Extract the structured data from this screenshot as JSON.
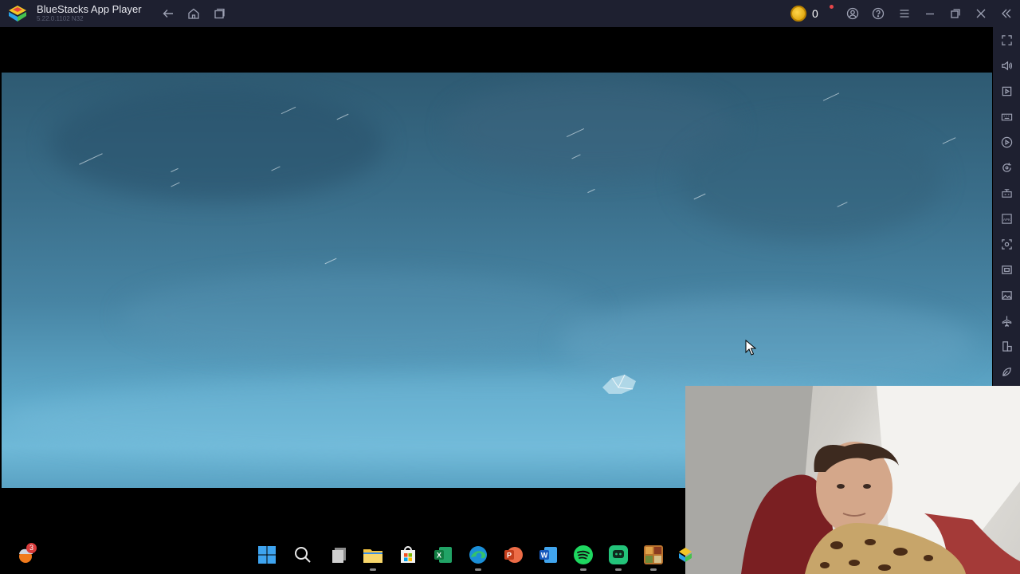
{
  "window": {
    "title": "BlueStacks App Player",
    "version": "5.22.0.1102  N32",
    "coins": "0"
  },
  "titlebar_buttons": [
    "back-icon",
    "home-icon",
    "multi-instance-icon",
    "account-icon",
    "help-icon",
    "menu-icon",
    "minimize-icon",
    "restore-icon",
    "close-icon",
    "collapse-sidebar-icon"
  ],
  "sidebar_buttons": [
    "fullscreen-icon",
    "volume-icon",
    "media-folder-icon",
    "keyboard-controls-icon",
    "macro-play-icon",
    "sync-icon",
    "game-controls-icon",
    "install-apk-icon",
    "screenshot-icon",
    "record-icon",
    "gallery-icon",
    "airplane-mode-icon",
    "rotate-icon",
    "eco-mode-icon"
  ],
  "taskbar": {
    "notification_badge": "3",
    "apps": [
      "windows-start-icon",
      "search-icon",
      "task-view-icon",
      "file-explorer-icon",
      "microsoft-store-icon",
      "excel-icon",
      "edge-icon",
      "powerpoint-icon",
      "word-icon",
      "spotify-icon",
      "messenger-icon",
      "game-app-icon",
      "bluestacks-taskbar-icon"
    ]
  },
  "colors": {
    "titlebar": "#1e2030",
    "accent_green": "#2fb84b",
    "coin": "#f2b705"
  }
}
